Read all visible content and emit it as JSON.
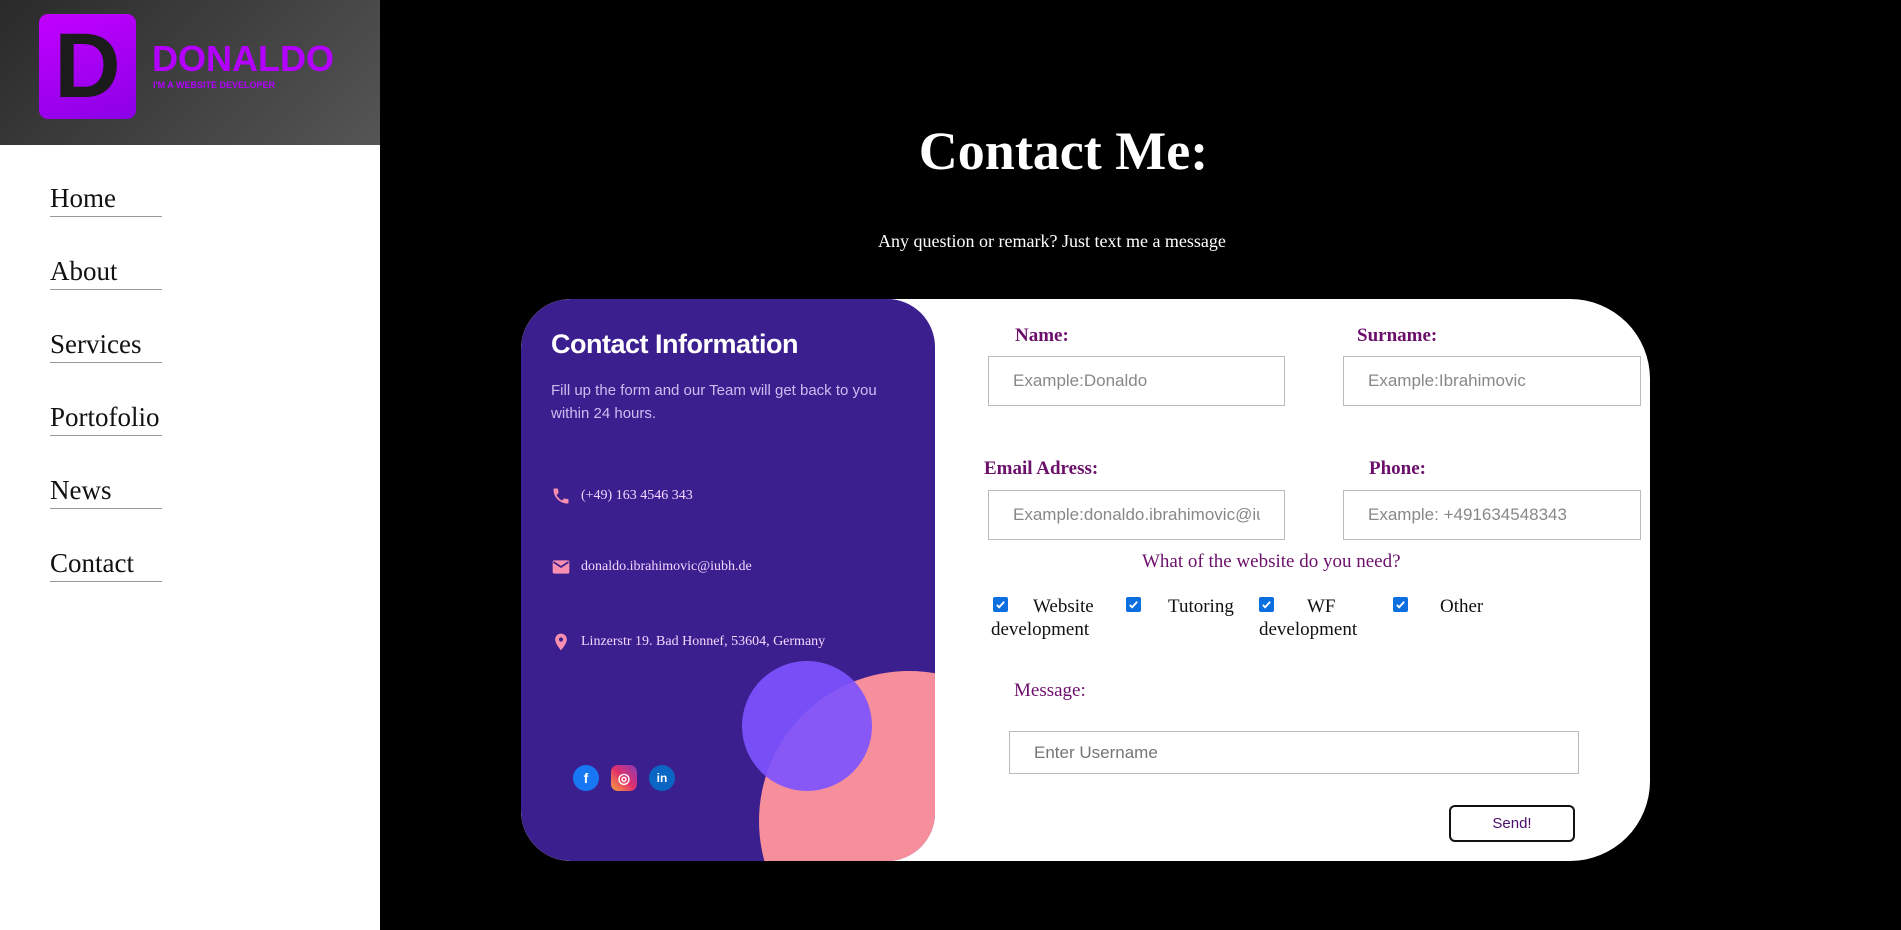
{
  "brand": {
    "letter": "D",
    "name": "DONALDO",
    "tagline": "I'M A WEBSITE DEVELOPER",
    "color": "#b300ff"
  },
  "nav": {
    "items": [
      {
        "label": "Home"
      },
      {
        "label": "About"
      },
      {
        "label": "Services"
      },
      {
        "label": "Portofolio"
      },
      {
        "label": "News"
      },
      {
        "label": "Contact"
      }
    ]
  },
  "page": {
    "title": "Contact Me:",
    "subtitle": "Any question or remark? Just text me a message"
  },
  "info": {
    "title": "Contact Information",
    "subtitle": "Fill up the form and our Team will get back to you within 24 hours.",
    "phone": {
      "icon": "phone-icon",
      "text": "(+49) 163 4546 343"
    },
    "email": {
      "icon": "mail-icon",
      "text": "donaldo.ibrahimovic@iubh.de"
    },
    "address": {
      "icon": "location-pin-icon",
      "text": "Linzerstr 19. Bad Honnef, 53604, Germany"
    },
    "socials": [
      {
        "icon": "facebook-icon",
        "glyph": "f"
      },
      {
        "icon": "instagram-icon",
        "glyph": "◎"
      },
      {
        "icon": "linkedin-icon",
        "glyph": "in"
      }
    ]
  },
  "form": {
    "name": {
      "label": "Name:",
      "placeholder": "Example:Donaldo"
    },
    "surname": {
      "label": "Surname:",
      "placeholder": "Example:Ibrahimovic"
    },
    "email": {
      "label": "Email Adress:",
      "placeholder": "Example:donaldo.ibrahimovic@iubh.de"
    },
    "phone": {
      "label": "Phone:",
      "placeholder": "Example: +491634548343"
    },
    "question": "What of the website do you need?",
    "options": [
      {
        "label": "Website development",
        "checked": true
      },
      {
        "label": "Tutoring",
        "checked": true
      },
      {
        "label": "WF development",
        "checked": true
      },
      {
        "label": "Other",
        "checked": true
      }
    ],
    "message": {
      "label": "Message:",
      "placeholder": "Enter Username"
    },
    "send_label": "Send!"
  },
  "colors": {
    "accent_purple": "#3c1f8f",
    "label_purple": "#6b0f6b",
    "checkbox_blue": "#0b6fe0",
    "pink": "#f68f9b"
  }
}
